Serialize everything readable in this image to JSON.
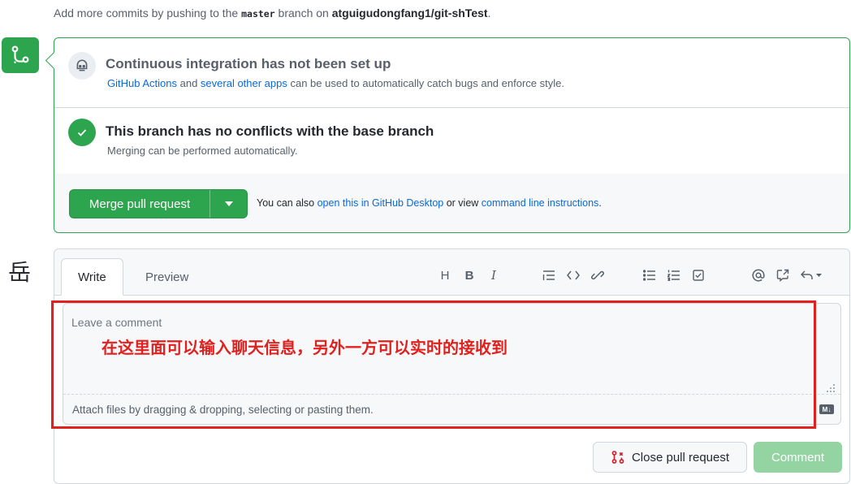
{
  "top_note": {
    "prefix": "Add more commits by pushing to the ",
    "branch": "master",
    "middle": " branch on ",
    "repo": "atguigudongfang1/git-shTest",
    "suffix": "."
  },
  "merge_box": {
    "ci": {
      "title": "Continuous integration has not been set up",
      "link1": "GitHub Actions",
      "and": " and ",
      "link2": "several other apps",
      "desc_rest": " can be used to automatically catch bugs and enforce style."
    },
    "conflicts": {
      "title": "This branch has no conflicts with the base branch",
      "desc": "Merging can be performed automatically."
    },
    "merge_button": "Merge pull request",
    "alt_prefix": "You can also ",
    "alt_link1": "open this in GitHub Desktop",
    "alt_middle": " or view ",
    "alt_link2": "command line instructions",
    "alt_suffix": "."
  },
  "avatar_char": "岳",
  "comment": {
    "tabs": [
      "Write",
      "Preview"
    ],
    "toolbar": {
      "heading": "H",
      "bold": "B",
      "italic": "I"
    },
    "placeholder": "Leave a comment",
    "annotation": "在这里面可以输入聊天信息，另外一方可以实时的接收到",
    "attach_text": "Attach files by dragging & dropping, selecting or pasting them.",
    "md_badge": "M↓"
  },
  "buttons": {
    "close": "Close pull request",
    "comment": "Comment"
  },
  "colors": {
    "green": "#2da44e",
    "link": "#0969da",
    "annotation_red": "#e0211e"
  }
}
